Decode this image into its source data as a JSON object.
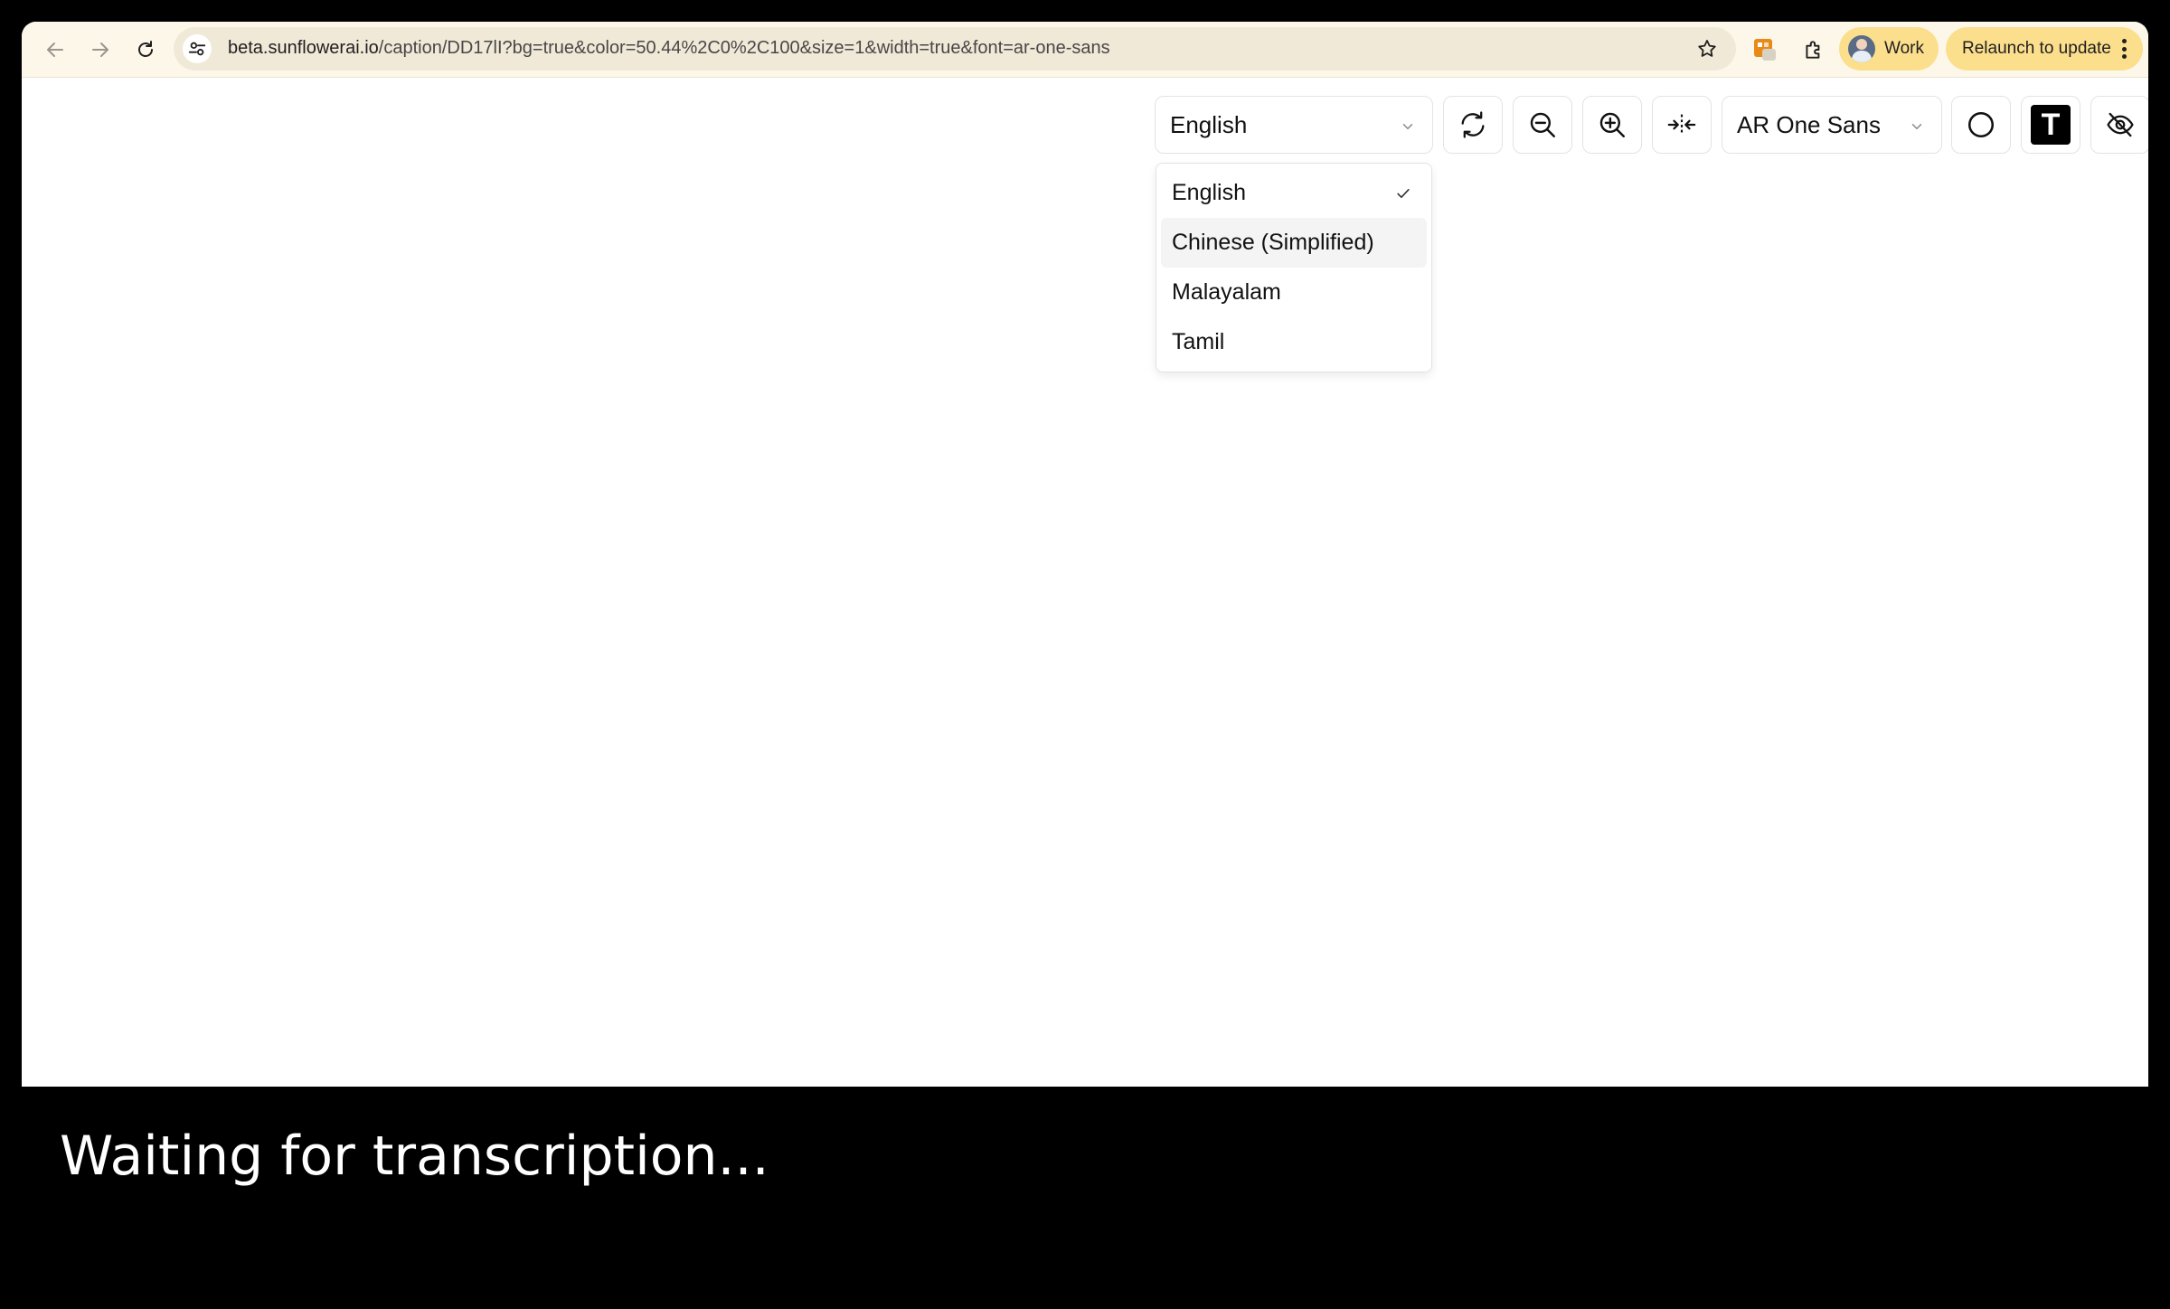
{
  "browser": {
    "url_host": "beta.sunflowerai.io",
    "url_path": "/caption/DD17lI?bg=true&color=50.44%2C0%2C100&size=1&width=true&font=ar-one-sans",
    "profile_label": "Work",
    "relaunch_label": "Relaunch to update"
  },
  "controls": {
    "language_selected": "English",
    "font_selected": "AR One Sans",
    "text_button_glyph": "T",
    "icons": [
      "refresh-icon",
      "zoom-out-icon",
      "zoom-in-icon",
      "width-icon",
      "circle-icon",
      "text-icon",
      "eye-off-icon"
    ]
  },
  "language_menu": {
    "options": [
      "English",
      "Chinese (Simplified)",
      "Malayalam",
      "Tamil"
    ],
    "checked": "English",
    "highlighted": "Chinese (Simplified)"
  },
  "caption": {
    "text": "Waiting for transcription..."
  },
  "colors": {
    "chip": "#fcdf8d",
    "toolbar": "#fdf7ea",
    "caption_bg": "#000000"
  }
}
